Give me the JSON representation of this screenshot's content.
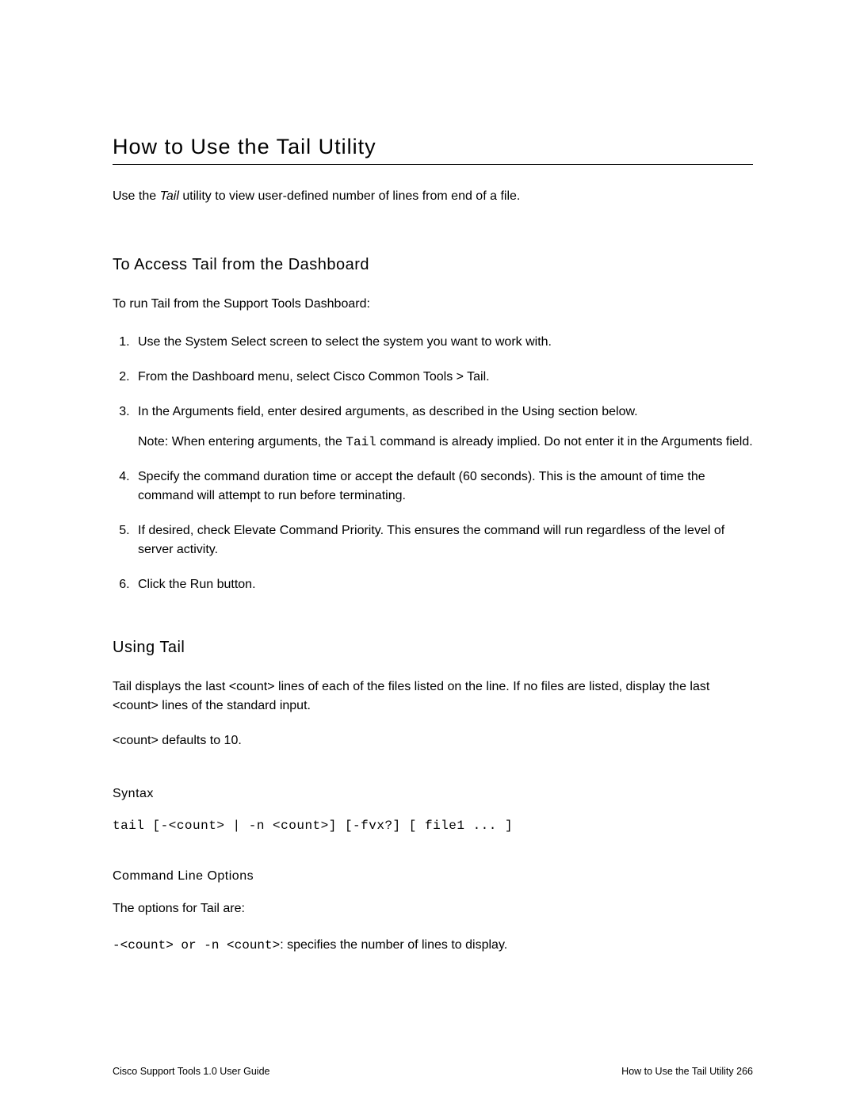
{
  "title": "How to Use the Tail Utility",
  "intro_prefix": "Use the ",
  "intro_italic": "Tail",
  "intro_suffix": " utility to view user-defined number of lines from end of a file.",
  "section_access": {
    "heading": "To Access Tail from the Dashboard",
    "lead": "To run Tail from the Support Tools Dashboard:",
    "steps": {
      "s1": "Use the System Select screen to select the system you want to work with.",
      "s2": "From the Dashboard menu, select Cisco Common Tools > Tail.",
      "s3a": "In the Arguments field, enter desired arguments, as described in the Using section below.",
      "s3note_prefix": "Note: When entering arguments, the ",
      "s3note_code": "Tail",
      "s3note_suffix": " command is already implied. Do not enter it in the Arguments field.",
      "s4": "Specify the command duration time or accept the default (60 seconds). This is the amount of time the command will attempt to run before terminating.",
      "s5": "If desired, check Elevate Command Priority. This ensures the command will run regardless of the level of server activity.",
      "s6": "Click the Run button."
    }
  },
  "section_using": {
    "heading": "Using Tail",
    "p1": "Tail displays the last <count> lines of each of the files listed on the line. If no files are listed, display the last <count> lines of the standard input.",
    "p2": "<count> defaults to 10.",
    "syntax_heading": "Syntax",
    "syntax_line": "tail [-<count> | -n <count>] [-fvx?] [ file1 ... ]",
    "options_heading": "Command Line Options",
    "options_lead": "The options for Tail are:",
    "opt_code": "-<count> or -n <count>",
    "opt_desc": ": specifies the number of lines to display."
  },
  "footer": {
    "left": "Cisco Support Tools 1.0 User Guide",
    "right": "How to Use the Tail Utility   266"
  }
}
